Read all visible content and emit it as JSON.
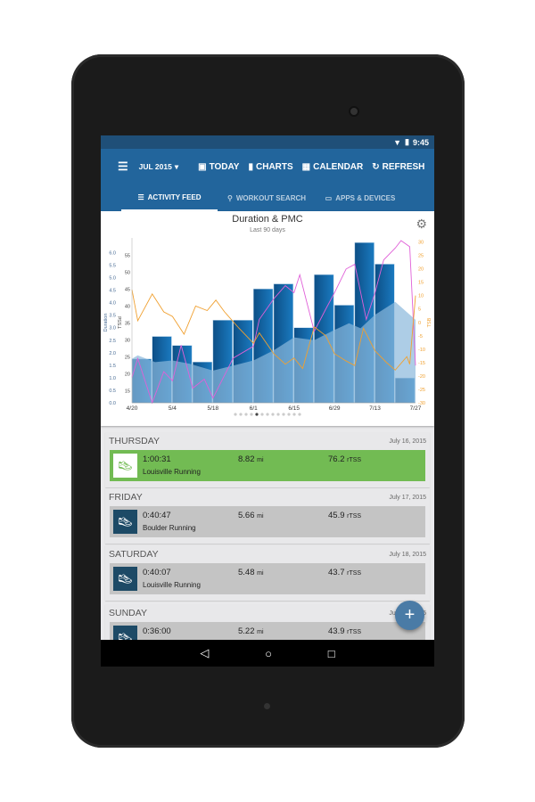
{
  "status": {
    "time": "9:45",
    "wifi_icon": "wifi-icon",
    "battery_icon": "battery-icon"
  },
  "appbar": {
    "month": "JUL 2015",
    "today": "TODAY",
    "charts": "CHARTS",
    "calendar": "CALENDAR",
    "refresh": "REFRESH"
  },
  "tabs": [
    {
      "label": "ACTIVITY FEED",
      "active": true
    },
    {
      "label": "WORKOUT SEARCH"
    },
    {
      "label": "APPS & DEVICES"
    }
  ],
  "colors": {
    "primary": "#22659c",
    "bar": "#1569a8",
    "ctl": "#8ab8dc",
    "atl": "#e060d8",
    "tsb": "#f0a030",
    "completed": "#72bb53",
    "planned": "#c4c4c4",
    "fab": "#4a7ba6"
  },
  "chart_data": {
    "type": "bar+line",
    "title": "Duration & PMC",
    "subtitle": "Last 90 days",
    "x_ticks": [
      "4/20",
      "5/4",
      "5/18",
      "6/1",
      "6/15",
      "6/29",
      "7/13",
      "7/27"
    ],
    "y_left_label": "Duration",
    "y_left_ticks": [
      "0.0",
      "0.5",
      "1.0",
      "1.5",
      "2.0",
      "2.5",
      "3.0",
      "3.5",
      "4.0",
      "4.5",
      "5.0",
      "5.5",
      "6.0"
    ],
    "y_left_range": [
      0,
      6.48
    ],
    "y_left2_label": "TSSd",
    "y_left2_ticks": [
      "15",
      "20",
      "25",
      "30",
      "35",
      "40",
      "45",
      "50",
      "55"
    ],
    "y_left2_range": [
      11.5,
      59.4
    ],
    "y_right_label": "TSB",
    "y_right_ticks": [
      "30",
      "25",
      "20",
      "15",
      "10",
      "5",
      "0",
      "-5",
      "-10",
      "-15",
      "-20",
      "-25",
      "-30"
    ],
    "y_right_range": [
      -30,
      30.5
    ],
    "bars": {
      "name": "Duration",
      "weeks": [
        "4/20",
        "4/27",
        "5/4",
        "5/11",
        "5/18",
        "5/25",
        "6/1",
        "6/8",
        "6/15",
        "6/22",
        "6/29",
        "7/6",
        "7/13",
        "7/20"
      ],
      "values": [
        1.75,
        2.65,
        2.29,
        1.63,
        3.3,
        3.3,
        4.55,
        4.75,
        3.0,
        5.12,
        3.9,
        6.4,
        5.54,
        0.99
      ]
    },
    "ctl": {
      "x": [
        "4/20",
        "4/22",
        "4/28",
        "5/4",
        "5/10",
        "5/18",
        "5/25",
        "6/1",
        "6/8",
        "6/15",
        "6/22",
        "6/29",
        "7/4",
        "7/8",
        "7/13",
        "7/20",
        "7/27"
      ],
      "y": [
        24.5,
        25.5,
        23.5,
        24,
        23,
        21,
        22.5,
        24,
        27,
        30.8,
        30,
        33,
        35,
        33.5,
        37.5,
        41.3,
        36
      ]
    },
    "atl": {
      "x": [
        "4/20",
        "4/22",
        "4/27",
        "5/1",
        "5/4",
        "5/7",
        "5/11",
        "5/15",
        "5/18",
        "5/25",
        "6/1",
        "6/3",
        "6/8",
        "6/12",
        "6/15",
        "6/17",
        "6/22",
        "6/26",
        "6/29",
        "7/3",
        "7/6",
        "7/10",
        "7/13",
        "7/16",
        "7/20",
        "7/22",
        "7/25",
        "7/27"
      ],
      "y": [
        19,
        24.6,
        11.5,
        20.7,
        18,
        28.5,
        15.8,
        18.5,
        12.9,
        24.7,
        28.2,
        36.1,
        42.2,
        46.1,
        44,
        49.3,
        32.6,
        39.2,
        44,
        51,
        52.4,
        36.1,
        44,
        53.7,
        57.2,
        59.4,
        57.6,
        22.5
      ]
    },
    "tsb": {
      "x": [
        "4/20",
        "4/22",
        "4/27",
        "5/1",
        "5/4",
        "5/8",
        "5/12",
        "5/16",
        "5/19",
        "5/22",
        "5/27",
        "6/1",
        "6/3",
        "6/8",
        "6/12",
        "6/15",
        "6/18",
        "6/22",
        "6/26",
        "6/29",
        "7/3",
        "7/6",
        "7/9",
        "7/13",
        "7/17",
        "7/20",
        "7/24",
        "7/25",
        "7/27"
      ],
      "y": [
        12.2,
        0.6,
        10.6,
        3.9,
        2.2,
        -4.4,
        6.1,
        4.4,
        8.3,
        3.9,
        -2.2,
        -7.8,
        -3.9,
        -11.7,
        -15.6,
        -13.3,
        -17.2,
        -1.7,
        -5,
        -11.7,
        -14.4,
        -16.1,
        -2.2,
        -10.6,
        -15,
        -17.8,
        -12.8,
        -15.6,
        10
      ]
    },
    "page_indicator": {
      "count": 13,
      "active": 4
    }
  },
  "feed": [
    {
      "day": "THURSDAY",
      "date": "July 16, 2015",
      "time": "1:00:31",
      "name": "Louisville Running",
      "distance": "8.82",
      "distance_unit": "mi",
      "tss": "76.2",
      "tss_unit": "rTSS",
      "completed": true
    },
    {
      "day": "FRIDAY",
      "date": "July 17, 2015",
      "time": "0:40:47",
      "name": "Boulder Running",
      "distance": "5.66",
      "distance_unit": "mi",
      "tss": "45.9",
      "tss_unit": "rTSS"
    },
    {
      "day": "SATURDAY",
      "date": "July 18, 2015",
      "time": "0:40:07",
      "name": "Louisville Running",
      "distance": "5.48",
      "distance_unit": "mi",
      "tss": "43.7",
      "tss_unit": "rTSS"
    },
    {
      "day": "SUNDAY",
      "date": "July 19, 2015",
      "time": "0:36:00",
      "name": "",
      "distance": "5.22",
      "distance_unit": "mi",
      "tss": "43.9",
      "tss_unit": "rTSS"
    }
  ],
  "fab": "+"
}
